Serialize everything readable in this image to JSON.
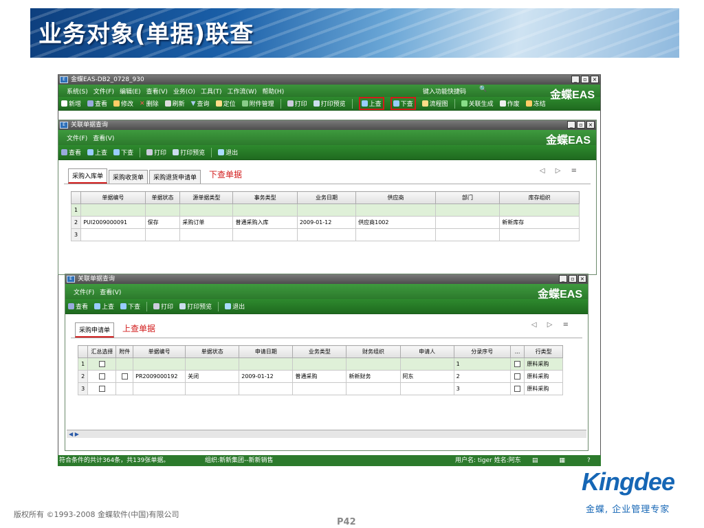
{
  "slide": {
    "title": "业务对象(单据)联查",
    "copyright": "版权所有 ©1993-2008 金蝶软件(中国)有限公司",
    "page": "P42",
    "logo": "Kingdee",
    "tagline": "金蝶, 企业管理专家"
  },
  "main_window": {
    "title": "金蝶EAS-DB2_0728_930",
    "menu": [
      "系统(S)",
      "文件(F)",
      "编辑(E)",
      "查看(V)",
      "业务(O)",
      "工具(T)",
      "工作流(W)",
      "帮助(H)"
    ],
    "quick_search": "键入功能快捷码",
    "brand": "金蝶EAS",
    "toolbar": [
      "新增",
      "查看",
      "修改",
      "删除",
      "刷新",
      "查询",
      "定位",
      "附件管理",
      "打印",
      "打印预览",
      "上查",
      "下查",
      "流程图",
      "关联生成",
      "作废",
      "冻结"
    ]
  },
  "win1": {
    "title": "关联单据查询",
    "menu": [
      "文件(F)",
      "查看(V)"
    ],
    "brand": "金蝶EAS",
    "toolbar": [
      "查看",
      "上查",
      "下查",
      "打印",
      "打印预览",
      "退出"
    ],
    "tabs": [
      "采购入库单",
      "采购收货单",
      "采购退货申请单"
    ],
    "note": "下查单据",
    "columns": [
      "单据编号",
      "单据状态",
      "源单据类型",
      "事务类型",
      "业务日期",
      "供应商",
      "部门",
      "库存组织"
    ],
    "rows": [
      [
        "1",
        "",
        "",
        "",
        "",
        "",
        "",
        "",
        ""
      ],
      [
        "2",
        "PUI2009000091",
        "保存",
        "采购订单",
        "普通采购入库",
        "2009-01-12",
        "供应商1002",
        "",
        "新新库存"
      ],
      [
        "3",
        "",
        "",
        "",
        "",
        "",
        "",
        "",
        ""
      ]
    ]
  },
  "win2": {
    "title": "关联单据查询",
    "menu": [
      "文件(F)",
      "查看(V)"
    ],
    "brand": "金蝶EAS",
    "toolbar": [
      "查看",
      "上查",
      "下查",
      "打印",
      "打印预览",
      "退出"
    ],
    "tabs": [
      "采购申请单"
    ],
    "note": "上查单据",
    "columns": [
      "汇总选择",
      "附件",
      "单据编号",
      "单据状态",
      "申请日期",
      "业务类型",
      "财务组织",
      "申请人",
      "分录序号",
      "...",
      "行类型"
    ],
    "rows": [
      [
        "1",
        "",
        "",
        "",
        "",
        "",
        "",
        "",
        "1",
        "",
        "原料采购"
      ],
      [
        "2",
        "",
        "PR2009000192",
        "关闭",
        "2009-01-12",
        "普通采购",
        "新新财务",
        "阿东",
        "2",
        "",
        "原料采购"
      ],
      [
        "3",
        "",
        "",
        "",
        "",
        "",
        "",
        "",
        "3",
        "",
        "原料采购"
      ]
    ]
  },
  "status": {
    "count": "符合条件的共计364条，共139张单据。",
    "org": "组织:新新集团--新新销售",
    "user": "用户名: tiger 姓名:阿东"
  },
  "colors": {
    "green": "#2c7a2c",
    "red": "#d21b1b",
    "blue": "#1566b5"
  }
}
